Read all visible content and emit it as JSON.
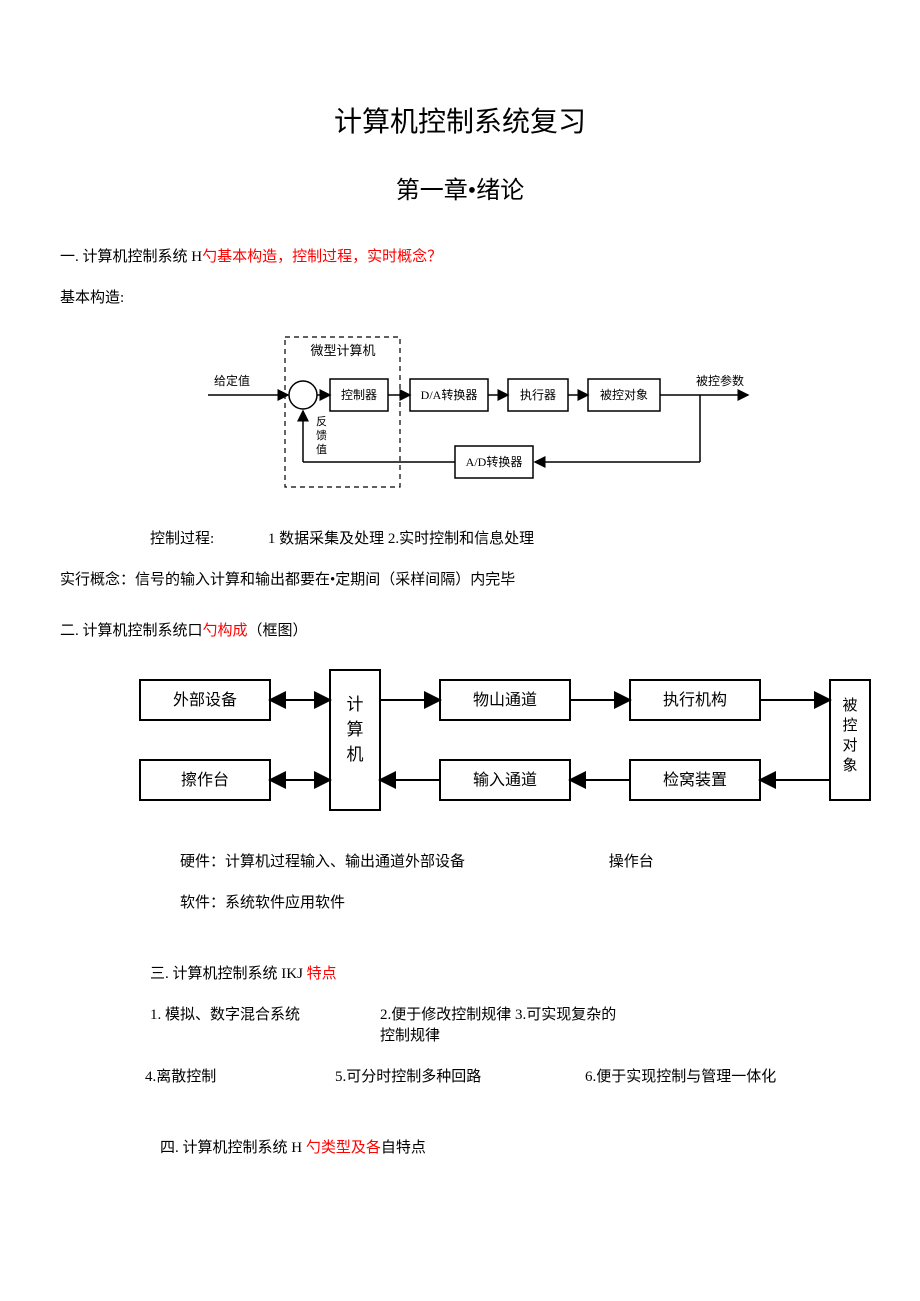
{
  "title": "计算机控制系统复习",
  "chapter": "第一章•绪论",
  "s1": {
    "head_a": "一. 计算机控制系统 H",
    "head_b": "勺基本构造，控制过程，实时概念？",
    "basic": "基本构造:",
    "d1": {
      "box_top": "微型计算机",
      "inlabel": "给定值",
      "ctrl": "控制器",
      "da": "D/A转换器",
      "exec": "执行器",
      "obj": "被控对象",
      "outlabel": "被控参数",
      "ad": "A/D转换器",
      "fb1": "反",
      "fb2": "馈",
      "fb3": "值"
    },
    "proc_label": "控制过程:",
    "proc_text": "1 数据采集及处理 2.实时控制和信息处理",
    "realtime": "实行概念：信号的输入计算和输出都要在•定期间（采样间隔）内完毕"
  },
  "s2": {
    "head_a": "二. 计算机控制系统口",
    "head_b": "勺构成",
    "head_c": "（框图）",
    "d2": {
      "ext": "外部设备",
      "cpu": "计算机",
      "out": "物山通道",
      "act": "执行机构",
      "console": "擦作台",
      "in": "输入通道",
      "det": "检窝装置",
      "target": "被控对象"
    },
    "hw_a": "硬件：计算机过程输入、输出通道外部设备",
    "hw_b": "操作台",
    "sw": "软件：系统软件应用软件"
  },
  "s3": {
    "head_a": "三. 计算机控制系统 IKJ ",
    "head_b": "特点",
    "f1": "1. 模拟、数字混合系统",
    "f2": "2.便于修改控制规律",
    "f3": "3.可实现复杂的控制规律",
    "f4": "4.离散控制",
    "f5": "5.可分时控制多种回路",
    "f6": "6.便于实现控制与管理一体化"
  },
  "s4": {
    "head_a": "四. 计算机控制系统 H ",
    "head_b": "勺类型及各",
    "head_c": "自特点"
  }
}
